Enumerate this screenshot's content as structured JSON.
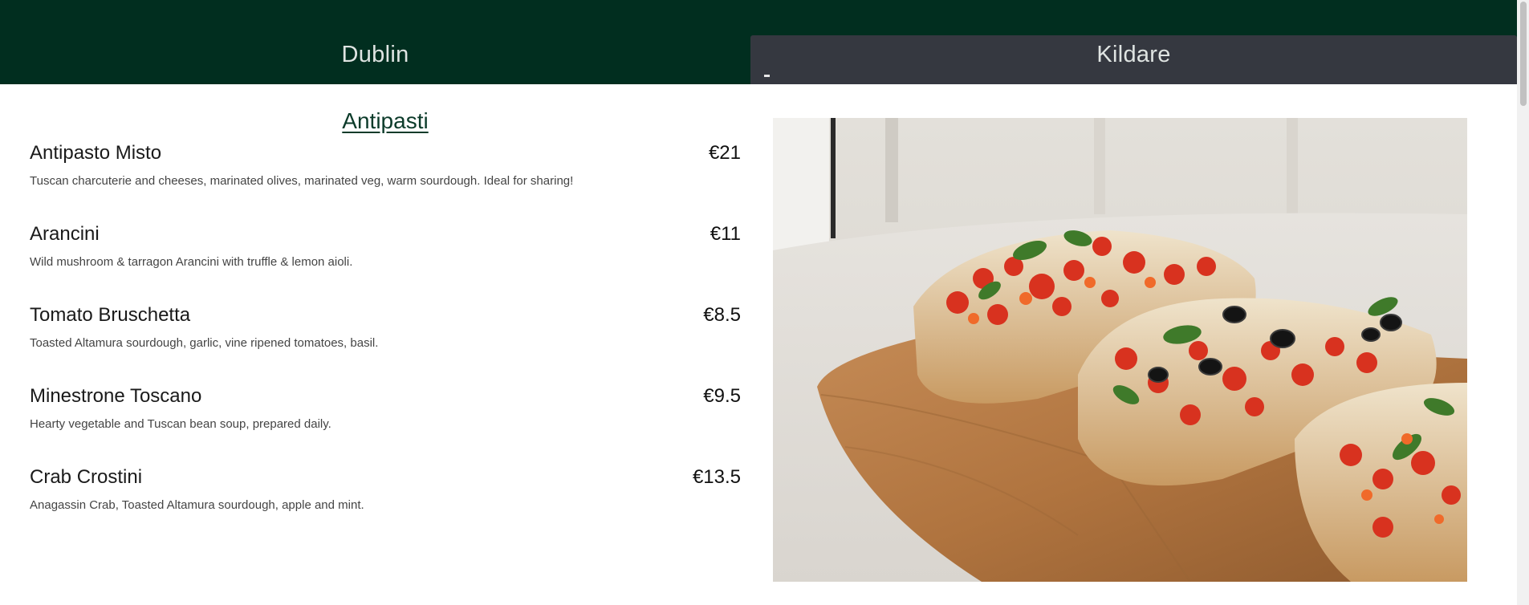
{
  "tabs": [
    {
      "label": "Dublin",
      "active": false
    },
    {
      "label": "Kildare",
      "active": true
    }
  ],
  "menu": {
    "section_title": "Antipasti",
    "items": [
      {
        "name": "Antipasto Misto",
        "price": "€21",
        "description": "Tuscan charcuterie and cheeses, marinated olives, marinated veg, warm sourdough. Ideal for sharing!"
      },
      {
        "name": "Arancini",
        "price": "€11",
        "description": "Wild mushroom & tarragon Arancini with truffle & lemon aioli."
      },
      {
        "name": "Tomato Bruschetta",
        "price": "€8.5",
        "description": "Toasted Altamura sourdough, garlic, vine ripened tomatoes, basil."
      },
      {
        "name": "Minestrone Toscano",
        "price": "€9.5",
        "description": "Hearty vegetable and Tuscan bean soup, prepared daily."
      },
      {
        "name": "Crab Crostini",
        "price": "€13.5",
        "description": "Anagassin Crab, Toasted Altamura sourdough, apple and mint."
      }
    ]
  },
  "colors": {
    "header_bg": "#012e1f",
    "active_tab_bg": "#353840",
    "section_title": "#0c3b2a"
  },
  "photo": {
    "subject": "bruschetta-on-wooden-board"
  }
}
